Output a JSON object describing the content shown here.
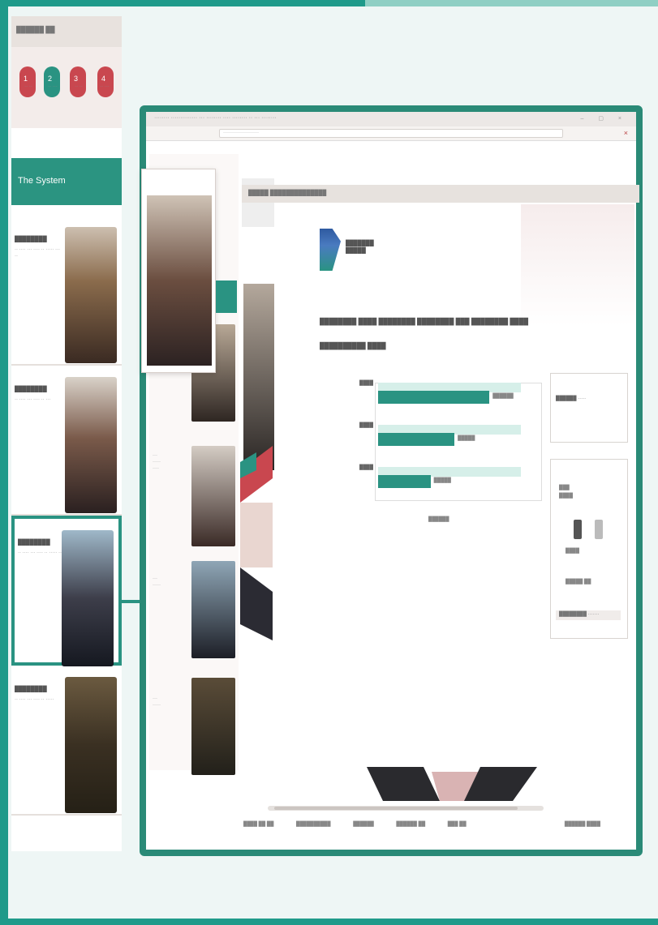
{
  "left_panel": {
    "header": "██████ ██",
    "pins": [
      {
        "num": "1",
        "color": "#c9474f",
        "caption": "·· ··"
      },
      {
        "num": "2",
        "color": "#2a9382",
        "caption": "·· ···"
      },
      {
        "num": "3",
        "color": "#c9474f",
        "caption": "·· ··"
      },
      {
        "num": "4",
        "color": "#c9474f",
        "caption": "·· ···"
      }
    ],
    "title": "The System",
    "items": [
      {
        "label": "████████",
        "text": "·· ···· ··· ···· ·· ····· ··· ··"
      },
      {
        "label": "████████",
        "text": "·· ···· ··· ···· ·· ···"
      },
      {
        "label": "████████",
        "text": "·· ···· ··· ···· ·· ····· ··"
      },
      {
        "label": "████████",
        "text": "·· ···· ··· ···· ·· ·····"
      }
    ]
  },
  "window": {
    "title": "········ ·············· ··· ········ ···· ········ ·· ··· ········",
    "controls": "–  ▢  ×",
    "address": "······················",
    "close_icon": "×"
  },
  "content": {
    "header": "█████  ██████████████",
    "logo_text": "███████\n█████",
    "question_line1": "████████ ████ ████████ ████████ ███ ████████ ████",
    "question_line2": "██████████ ████"
  },
  "chart_data": {
    "type": "bar",
    "categories": [
      "████",
      "████",
      "████"
    ],
    "values": [
      70,
      48,
      33
    ],
    "xlim": [
      0,
      100
    ],
    "value_labels": [
      "██████",
      "█████",
      "█████"
    ],
    "xlabel": "██████"
  },
  "right_panel": {
    "box1_text": "██████  ·····",
    "box2_lines": [
      "███",
      "████"
    ],
    "caption1": "████",
    "caption2": "█████ ██",
    "bottom": "████████ ·······"
  },
  "footer": {
    "links": [
      "████ ██ ██",
      "██████████",
      "██████",
      "██████ ██",
      "███ ██"
    ],
    "right": "██████ ████"
  }
}
